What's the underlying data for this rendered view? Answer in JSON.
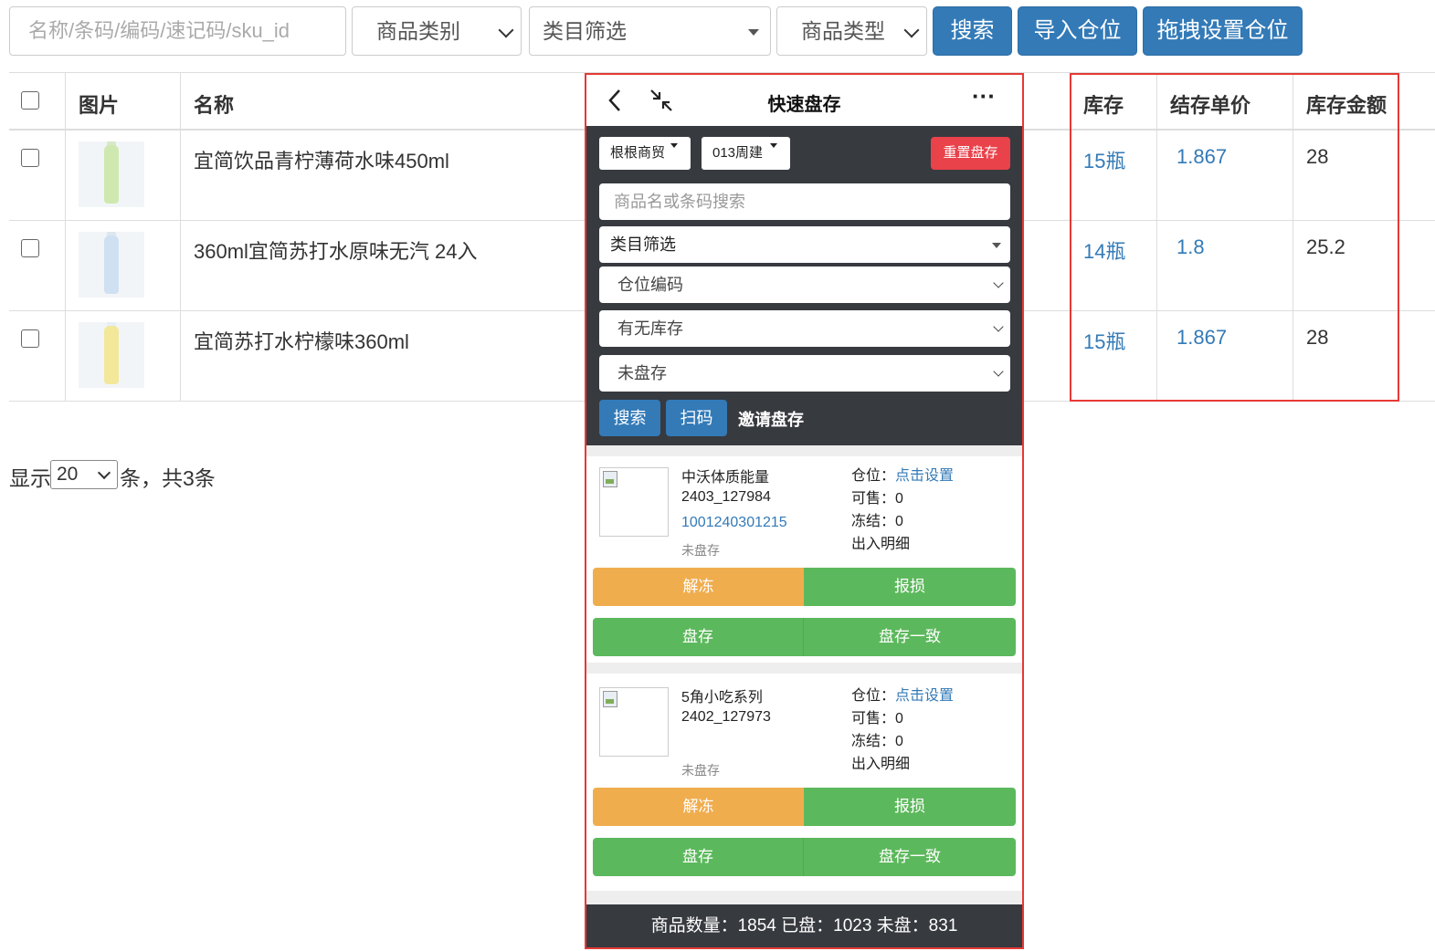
{
  "toolbar": {
    "search_placeholder": "名称/条码/编码/速记码/sku_id",
    "category_select": "商品类别",
    "category_filter": "类目筛选",
    "type_select": "商品类型",
    "search_btn": "搜索",
    "import_btn": "导入仓位",
    "drag_btn": "拖拽设置仓位"
  },
  "table": {
    "headers": {
      "image": "图片",
      "name": "名称",
      "stock": "库存",
      "unit_price": "结存单价",
      "amount": "库存金额"
    },
    "rows": [
      {
        "name": "宜简饮品青柠薄荷水味450ml",
        "stock": "15瓶",
        "unit_price": "1.867",
        "amount": "28",
        "bottle_color": "#cfe8b0"
      },
      {
        "name": "360ml宜简苏打水原味无汽 24入",
        "stock": "14瓶",
        "unit_price": "1.8",
        "amount": "25.2",
        "bottle_color": "#cfe0f3"
      },
      {
        "name": "宜简苏打水柠檬味360ml",
        "stock": "15瓶",
        "unit_price": "1.867",
        "amount": "28",
        "bottle_color": "#f3e79a"
      }
    ]
  },
  "pager": {
    "prefix": "显示",
    "page_size": "20",
    "suffix": "条，共3条"
  },
  "phone": {
    "title": "快速盘存",
    "more": "···",
    "store_chip": "根根商贸",
    "week_chip": "013周建",
    "reset_btn": "重置盘存",
    "search_placeholder": "商品名或条码搜索",
    "category_filter": "类目筛选",
    "location_select": "仓位编码",
    "stock_select": "有无库存",
    "status_select": "未盘存",
    "search_btn": "搜索",
    "scan_btn": "扫码",
    "invite_label": "邀请盘存",
    "items": [
      {
        "name": "中沃体质能量",
        "code": "2403_127984",
        "barcode": "1001240301215",
        "status": "未盘存",
        "location_label": "仓位：",
        "location_link": "点击设置",
        "sellable": "可售：",
        "sellable_value": "0",
        "frozen": "冻结：",
        "frozen_value": "0",
        "detail_link": "出入明细",
        "unfreeze": "解冻",
        "damage": "报损",
        "count": "盘存",
        "count_match": "盘存一致"
      },
      {
        "name": "5角小吃系列",
        "code": "2402_127973",
        "barcode": "",
        "status": "未盘存",
        "location_label": "仓位：",
        "location_link": "点击设置",
        "sellable": "可售：",
        "sellable_value": "0",
        "frozen": "冻结：",
        "frozen_value": "0",
        "detail_link": "出入明细",
        "unfreeze": "解冻",
        "damage": "报损",
        "count": "盘存",
        "count_match": "盘存一致"
      }
    ],
    "footer": "商品数量：1854 已盘：1023 未盘：831"
  },
  "colors": {
    "primary": "#337ab7",
    "danger": "#e9424b",
    "warning": "#f0ad4e",
    "success": "#5cb85c",
    "dark": "#373a3f",
    "highlight": "#e53935"
  }
}
